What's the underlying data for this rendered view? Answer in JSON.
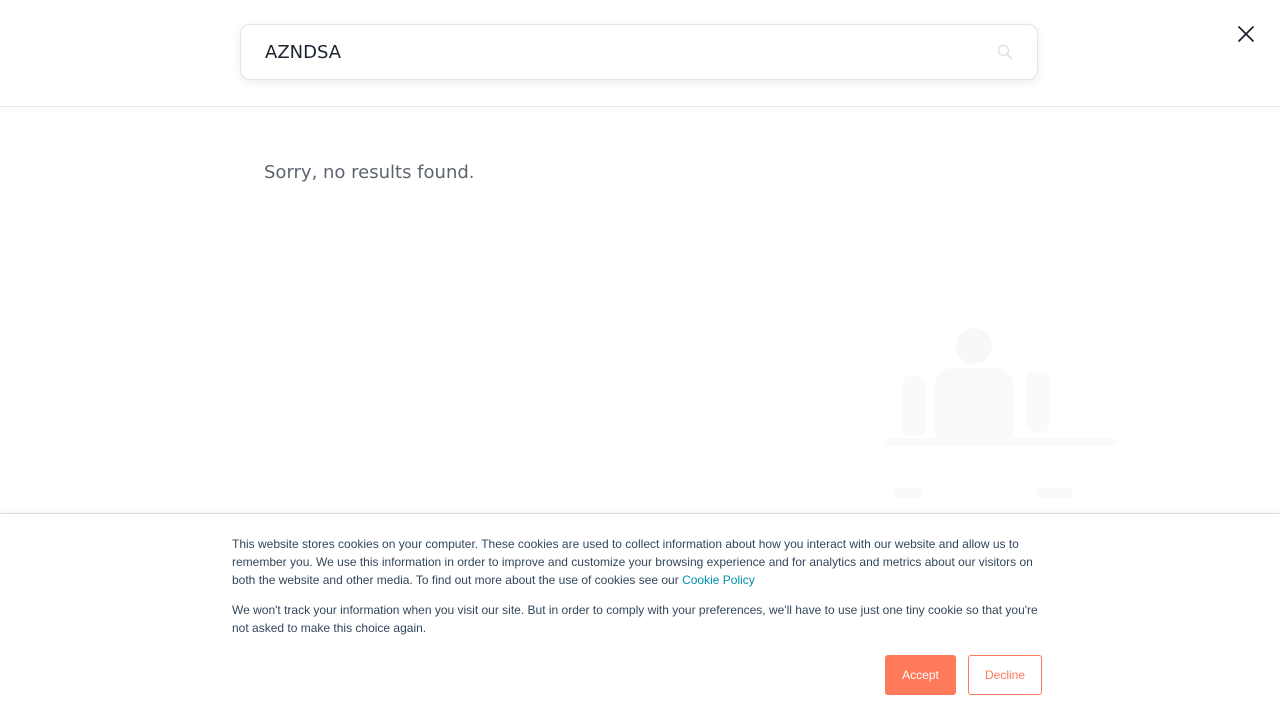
{
  "search": {
    "value": "AZNDSA",
    "placeholder": ""
  },
  "results": {
    "message": "Sorry, no results found."
  },
  "cookie_banner": {
    "paragraph1_text": "This website stores cookies on your computer. These cookies are used to collect information about how you interact with our website and allow us to remember you. We use this information in order to improve and customize your browsing experience and for analytics and metrics about our visitors on both the website and other media. To find out more about the use of cookies see our ",
    "policy_link": "Cookie Policy",
    "paragraph2_text": "We won't track your information when you visit our site. But in order to comply with your preferences, we'll have to use just one tiny cookie so that you're not asked to make this choice again.",
    "accept_label": "Accept",
    "decline_label": "Decline"
  },
  "icons": {
    "search": "search-icon",
    "close": "close-icon"
  },
  "colors": {
    "accent": "#ff7a59",
    "link": "#0091ae",
    "banner_text": "#33475b",
    "muted_text": "#5d6470"
  }
}
